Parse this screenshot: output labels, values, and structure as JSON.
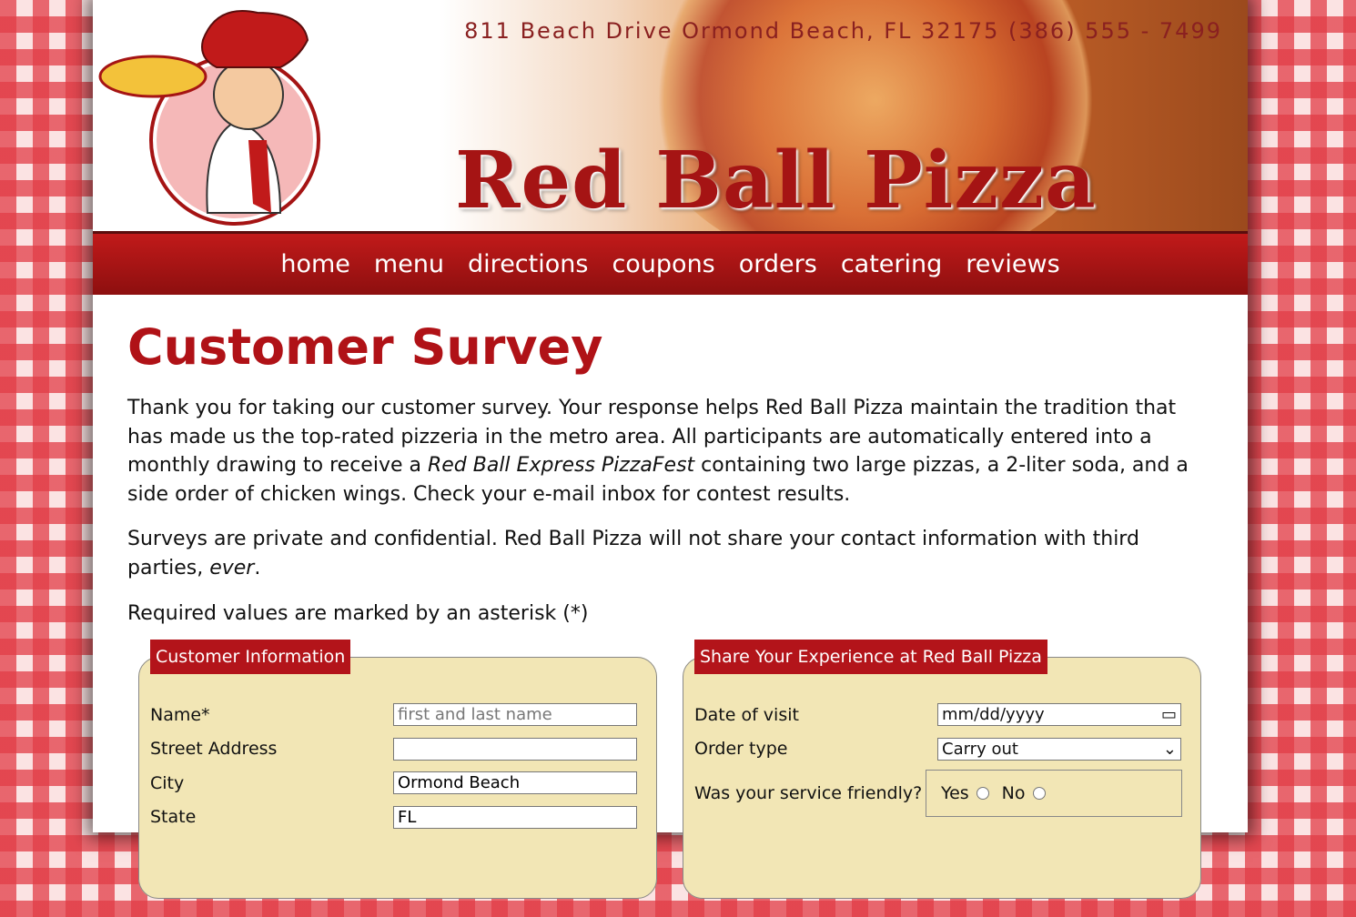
{
  "header": {
    "address": "811 Beach Drive  Ormond Beach, FL 32175   (386) 555 - 7499",
    "brand": "Red Ball Pizza"
  },
  "nav": [
    "home",
    "menu",
    "directions",
    "coupons",
    "orders",
    "catering",
    "reviews"
  ],
  "main": {
    "title": "Customer Survey",
    "intro_a": "Thank you for taking our customer survey. Your response helps Red Ball Pizza maintain the tradition that has made us the top-rated pizzeria in the metro area. All participants are automatically entered into a monthly drawing to receive a ",
    "intro_em": "Red Ball Express PizzaFest",
    "intro_b": " containing two large pizzas, a 2-liter soda, and a side order of chicken wings. Check your e-mail inbox for contest results.",
    "privacy_a": "Surveys are private and confidential. Red Ball Pizza will not share your contact information with third parties, ",
    "privacy_em": "ever",
    "privacy_b": ".",
    "required": "Required values are marked by an asterisk (*)"
  },
  "customer": {
    "legend": "Customer Information",
    "name_label": "Name*",
    "name_placeholder": "first and last name",
    "street_label": "Street Address",
    "street_value": "",
    "city_label": "City",
    "city_value": "Ormond Beach",
    "state_label": "State",
    "state_value": "FL"
  },
  "experience": {
    "legend": "Share Your Experience at Red Ball Pizza",
    "date_label": "Date of visit",
    "date_placeholder": "mm/dd/yyyy",
    "order_label": "Order type",
    "order_value": "Carry out",
    "friendly_label": "Was your service friendly?",
    "yes": "Yes",
    "no": "No"
  },
  "colors": {
    "accent": "#b3141a",
    "fieldset_bg": "#f2e6b5"
  }
}
